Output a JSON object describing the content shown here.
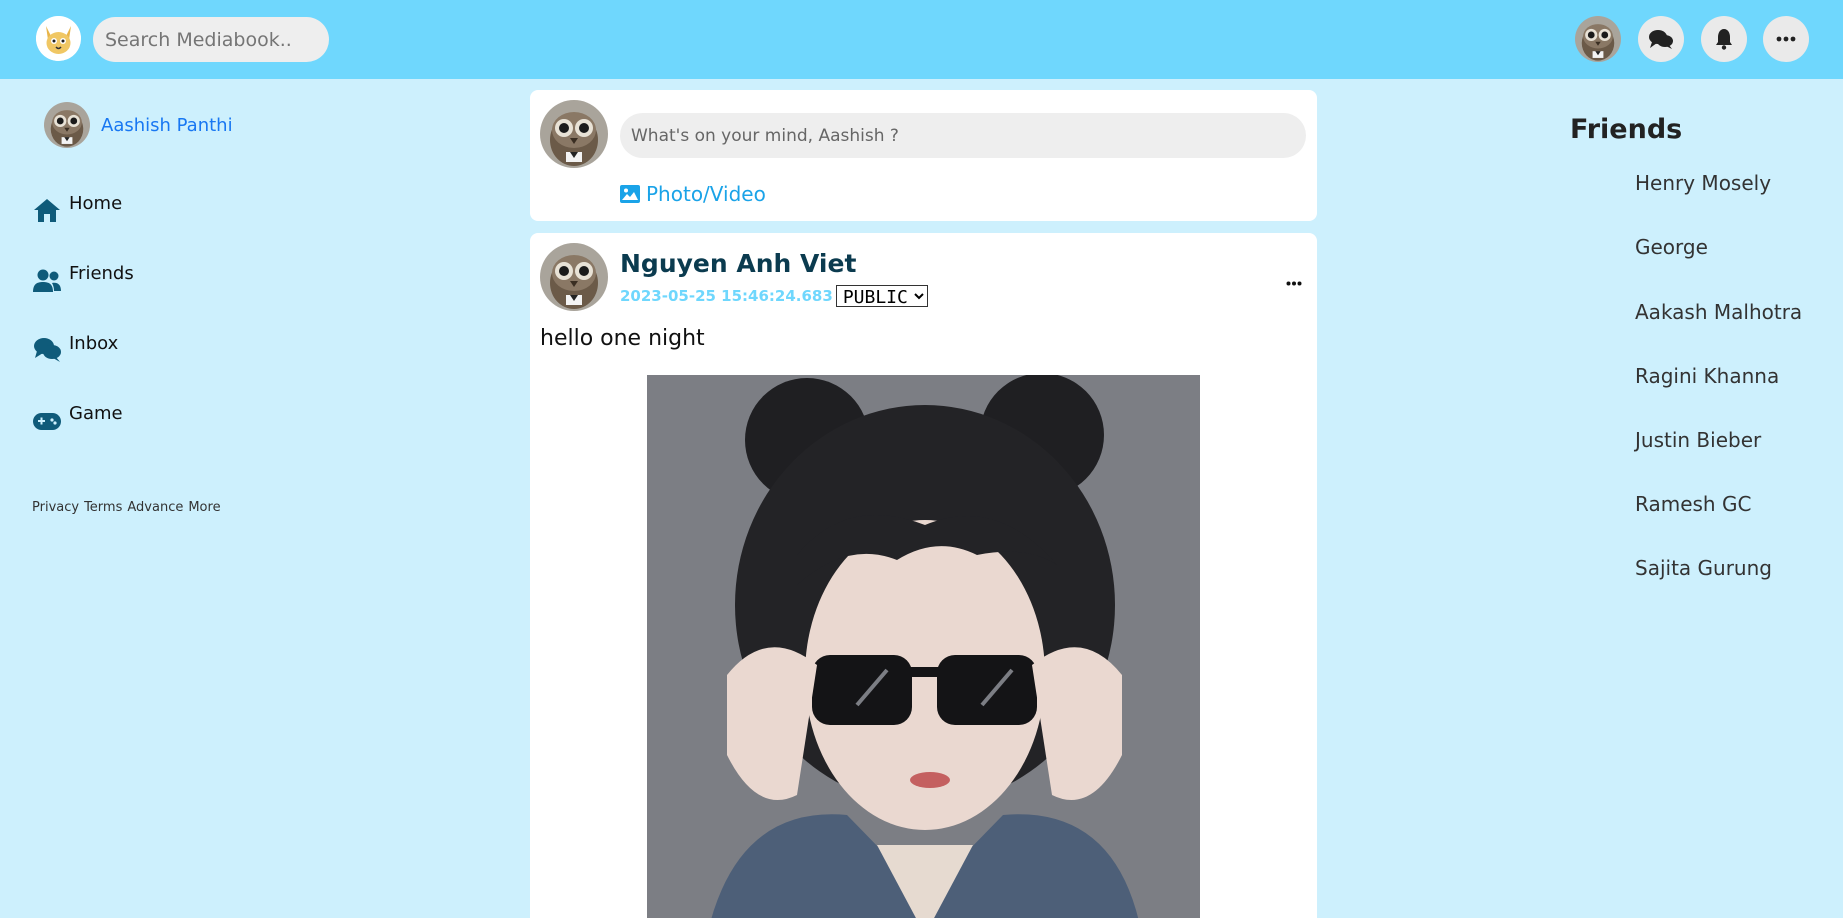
{
  "header": {
    "logo_icon": "dog-logo-icon",
    "search_placeholder": "Search Mediabook..",
    "icons": [
      "user-avatar",
      "messages-icon",
      "bell-icon",
      "more-icon"
    ]
  },
  "sidebar": {
    "profile_name": "Aashish Panthi",
    "items": [
      {
        "label": "Home",
        "icon": "home-icon"
      },
      {
        "label": "Friends",
        "icon": "friends-icon"
      },
      {
        "label": "Inbox",
        "icon": "inbox-icon"
      },
      {
        "label": "Game",
        "icon": "gamepad-icon"
      }
    ],
    "footer": [
      "Privacy",
      "Terms",
      "Advance",
      "More"
    ]
  },
  "composer": {
    "placeholder": "What's on your mind, Aashish ?",
    "photo_label": "Photo/Video"
  },
  "post": {
    "author": "Nguyen Anh Viet",
    "timestamp": "2023-05-25 15:46:24.683",
    "privacy_selected": "PUBLIC",
    "text": "hello one night"
  },
  "friends": {
    "title": "Friends",
    "list": [
      "Henry Mosely",
      "George",
      "Aakash Malhotra",
      "Ragini Khanna",
      "Justin Bieber",
      "Ramesh GC",
      "Sajita Gurung"
    ]
  },
  "colors": {
    "topbar": "#6fd7fd",
    "background": "#cdf0fd",
    "link": "#1877f2",
    "nav_icon": "#0f5b7a"
  }
}
